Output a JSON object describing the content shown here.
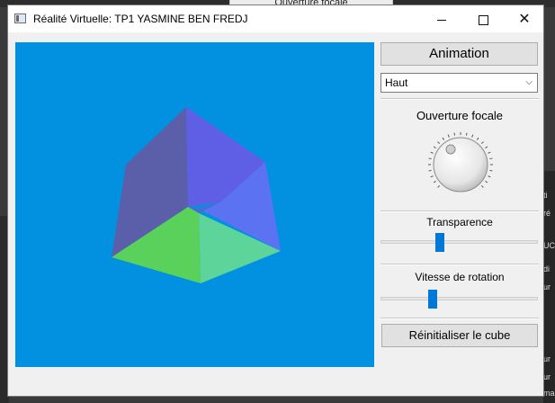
{
  "background": {
    "tab_label": "Ouverture focale",
    "right_fragments": [
      "ti",
      "ré",
      "UC",
      "di",
      "ur",
      "ur",
      "ur",
      "ma"
    ]
  },
  "window": {
    "title": "Réalité Virtuelle: TP1 YASMINE BEN FREDJ",
    "minimize_icon": "minimize-icon",
    "maximize_icon": "maximize-icon",
    "close_icon": "close-icon"
  },
  "viewport": {
    "background_color": "#0290e0",
    "cube_face_colors": [
      "#5b5ea8",
      "#5f5fe6",
      "#5b73f2",
      "#5ad15a",
      "#5cd49a"
    ]
  },
  "panel": {
    "animation_label": "Animation",
    "view_select": {
      "selected": "Haut",
      "icon": "chevron-down-icon"
    },
    "focal_label": "Ouverture focale",
    "transparency_label": "Transparence",
    "transparency_value": 0.37,
    "speed_label": "Vitesse de rotation",
    "speed_value": 0.32,
    "reset_label": "Réinitialiser le cube",
    "accent_color": "#0078d7"
  }
}
